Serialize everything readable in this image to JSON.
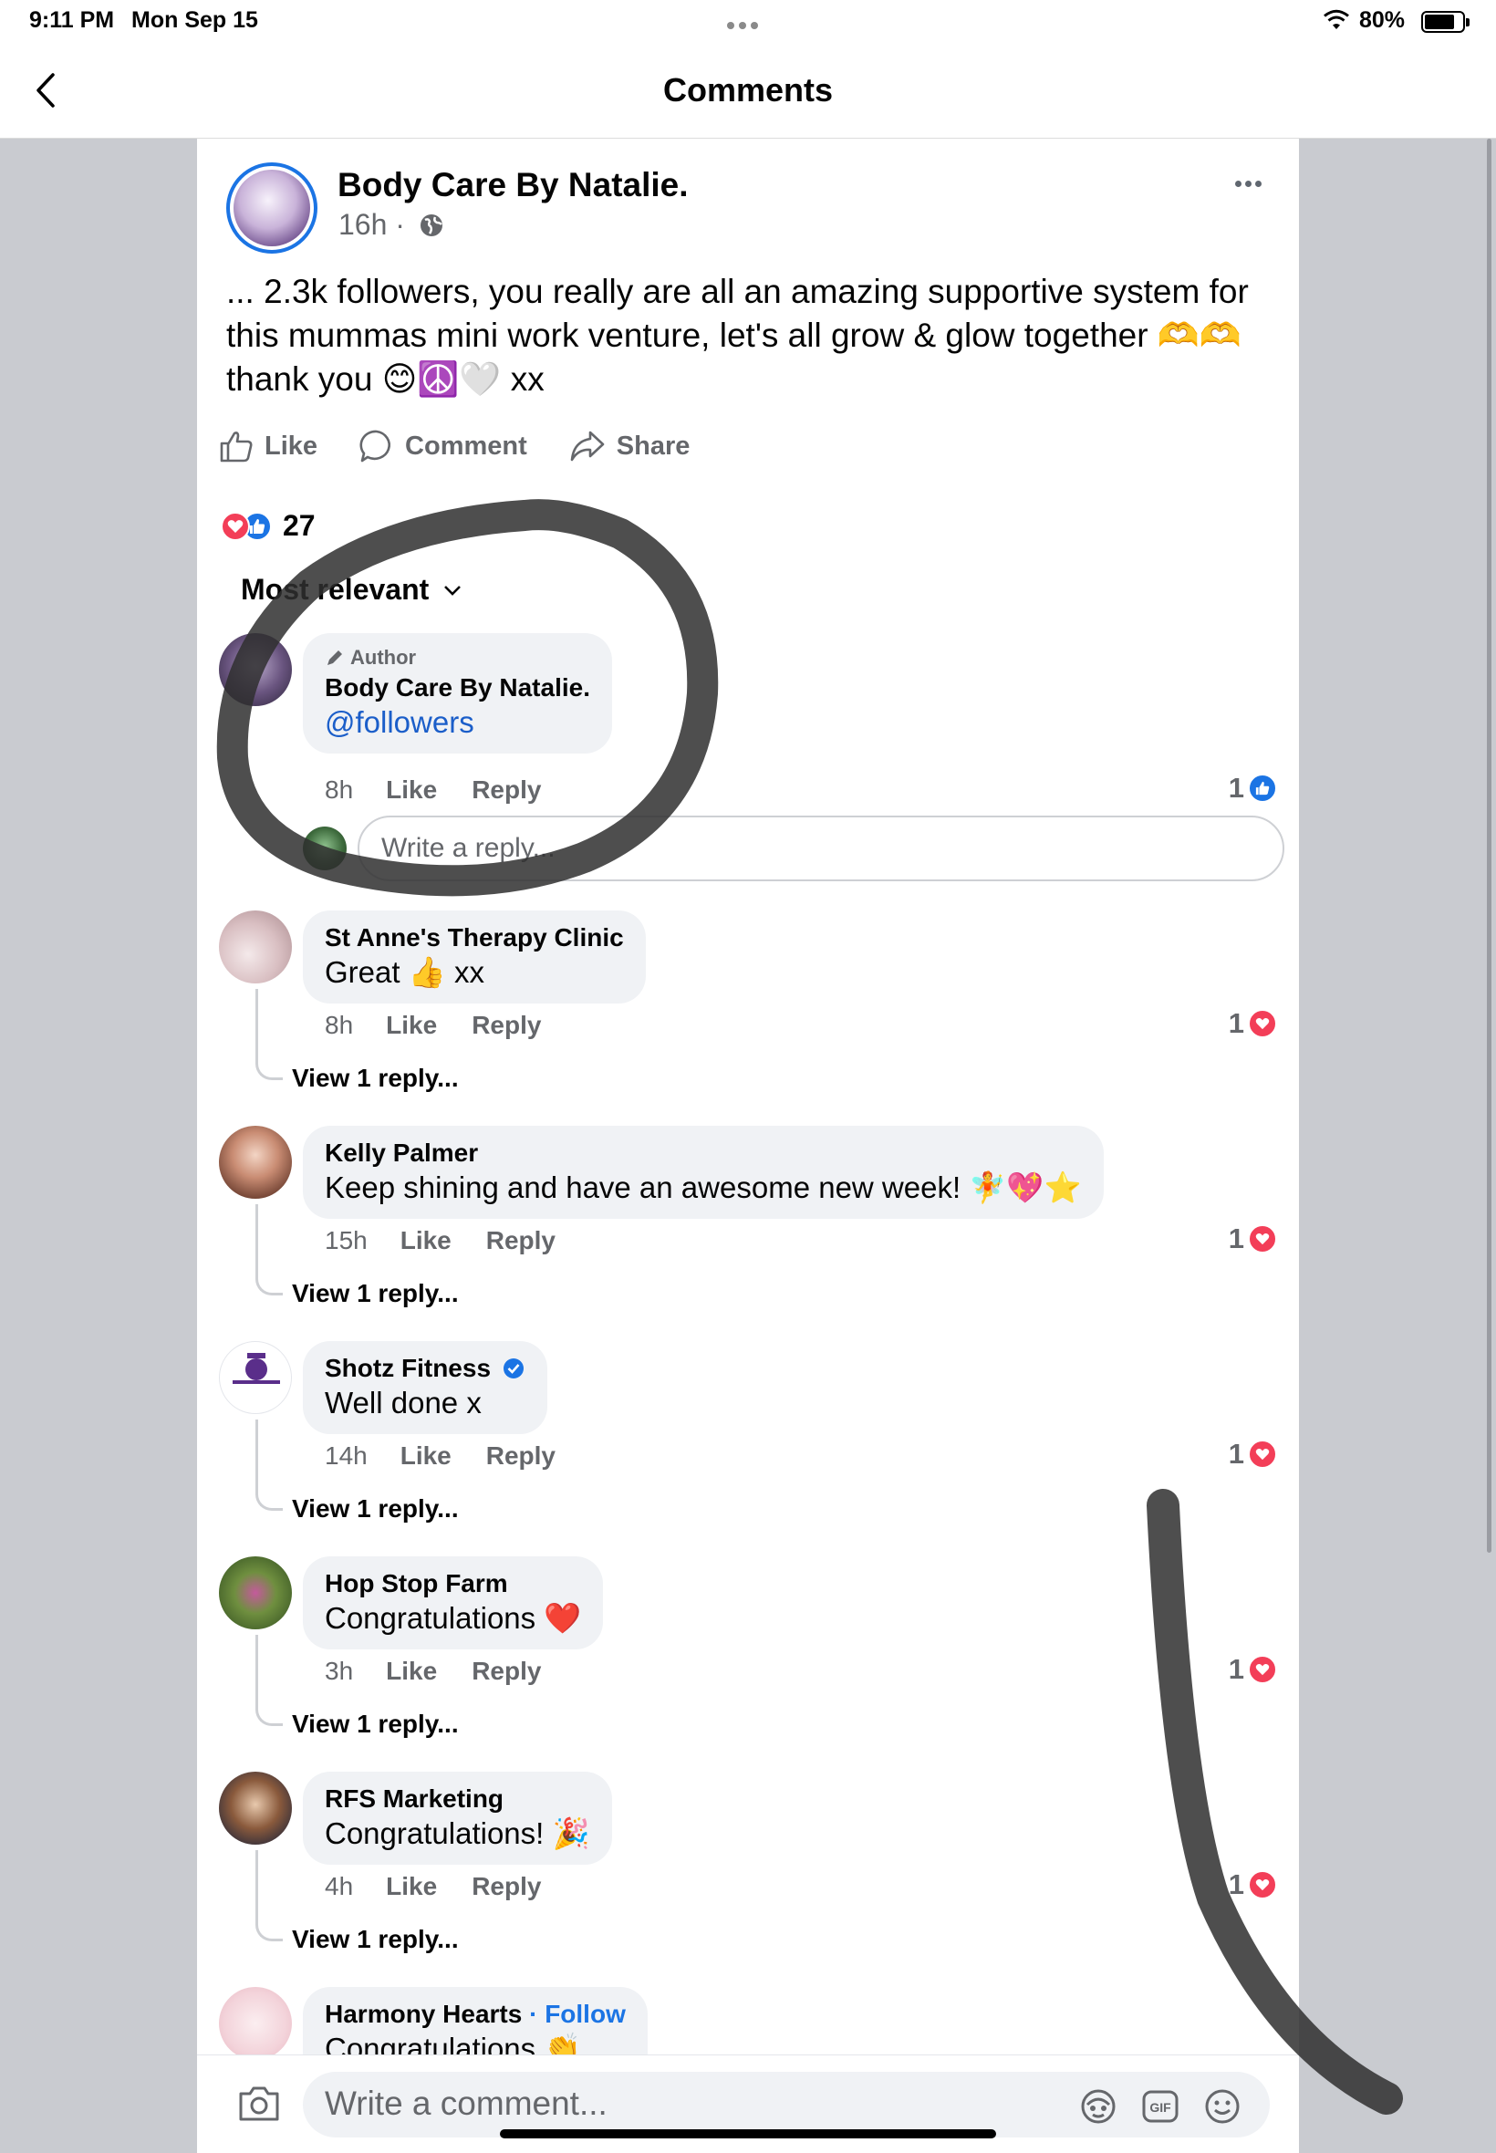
{
  "status": {
    "time": "9:11 PM",
    "date": "Mon Sep 15",
    "battery": "80%",
    "battery_level": 0.8
  },
  "nav": {
    "title": "Comments"
  },
  "post": {
    "page_name": "Body Care By Natalie.",
    "time": "16h ·",
    "text": "... 2.3k followers, you really are all an amazing supportive system for this mummas mini work venture, let's all grow & glow together 🫶🫶 thank you 😊☮️🤍 xx",
    "actions": {
      "like": "Like",
      "comment": "Comment",
      "share": "Share"
    },
    "reaction_count": "27"
  },
  "sort": {
    "label": "Most relevant"
  },
  "comments": [
    {
      "badge": "Author",
      "name": "Body Care By Natalie.",
      "text": "@followers",
      "time": "8h",
      "like": "Like",
      "reply": "Reply",
      "reaction_count": "1",
      "reaction": "like"
    },
    {
      "name": "St Anne's Therapy Clinic",
      "text": "Great 👍 xx",
      "time": "8h",
      "like": "Like",
      "reply": "Reply",
      "reaction_count": "1",
      "reaction": "love",
      "view_replies": "View 1 reply..."
    },
    {
      "name": "Kelly Palmer",
      "text": "Keep shining and have an awesome new week! 🧚💖⭐",
      "time": "15h",
      "like": "Like",
      "reply": "Reply",
      "reaction_count": "1",
      "reaction": "love",
      "view_replies": "View 1 reply..."
    },
    {
      "name": "Shotz Fitness",
      "text": "Well done x",
      "time": "14h",
      "like": "Like",
      "reply": "Reply",
      "reaction_count": "1",
      "reaction": "love",
      "view_replies": "View 1 reply..."
    },
    {
      "name": "Hop Stop Farm",
      "text": "Congratulations ❤️",
      "time": "3h",
      "like": "Like",
      "reply": "Reply",
      "reaction_count": "1",
      "reaction": "love",
      "view_replies": "View 1 reply..."
    },
    {
      "name": "RFS Marketing",
      "text": "Congratulations! 🎉",
      "time": "4h",
      "like": "Like",
      "reply": "Reply",
      "reaction_count": "1",
      "reaction": "love",
      "view_replies": "View 1 reply..."
    },
    {
      "name": "Harmony Hearts",
      "follow": "· Follow",
      "text": "Congratulations 👏"
    }
  ],
  "reply_box": {
    "placeholder": "Write a reply..."
  },
  "composer": {
    "placeholder": "Write a comment..."
  },
  "colors": {
    "accent": "#1b74e4",
    "love": "#f33e58",
    "side_gray": "#c9cbd0"
  }
}
